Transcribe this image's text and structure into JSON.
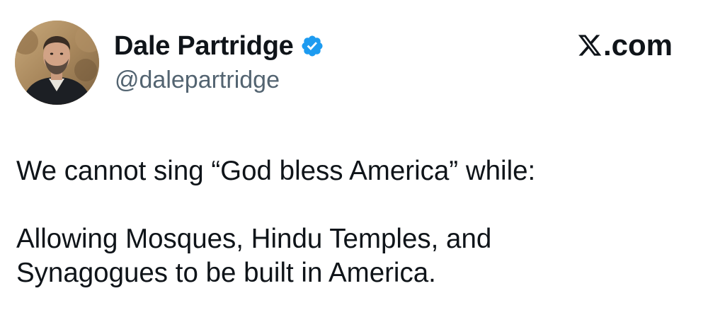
{
  "author": {
    "display_name": "Dale Partridge",
    "handle": "@dalepartridge",
    "verified": true
  },
  "site": {
    "label": ".com",
    "logo_icon": "x-logo-icon"
  },
  "tweet": {
    "line1": "We cannot sing “God bless America” while:",
    "line2": "Allowing Mosques, Hindu Temples, and",
    "line3": "Synagogues to be built in America."
  },
  "colors": {
    "verified_badge": "#1d9bf0",
    "handle_text": "#536471",
    "primary_text": "#0f1419"
  }
}
